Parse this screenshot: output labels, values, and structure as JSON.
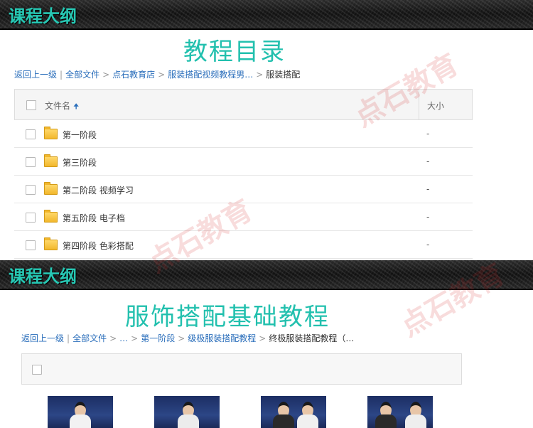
{
  "banner1": {
    "title": "课程大纲"
  },
  "section1": {
    "heading": "教程目录",
    "breadcrumb": [
      "返回上一级",
      "全部文件",
      "点石教育店",
      "服装搭配视频教程男…",
      "服装搭配"
    ]
  },
  "file_table": {
    "col_name": "文件名",
    "col_size": "大小",
    "rows": [
      {
        "name": "第一阶段",
        "size": "-"
      },
      {
        "name": "第三阶段",
        "size": "-"
      },
      {
        "name": "第二阶段  视频学习",
        "size": "-"
      },
      {
        "name": "第五阶段  电子档",
        "size": "-"
      },
      {
        "name": "第四阶段  色彩搭配",
        "size": "-"
      }
    ]
  },
  "banner2": {
    "title": "课程大纲"
  },
  "section2": {
    "heading": "服饰搭配基础教程",
    "breadcrumb": [
      "返回上一级",
      "全部文件",
      "…",
      "第一阶段",
      "级极服装搭配教程",
      "终极服装搭配教程（…"
    ]
  },
  "watermark": {
    "text": "点石教育"
  },
  "colors": {
    "accent": "#22c0ae",
    "link": "#2a6ebb",
    "watermark": "#d62828"
  },
  "icons": {
    "folder": "folder-icon",
    "sort": "sort-arrow-up-icon",
    "checkbox": "checkbox-icon"
  }
}
